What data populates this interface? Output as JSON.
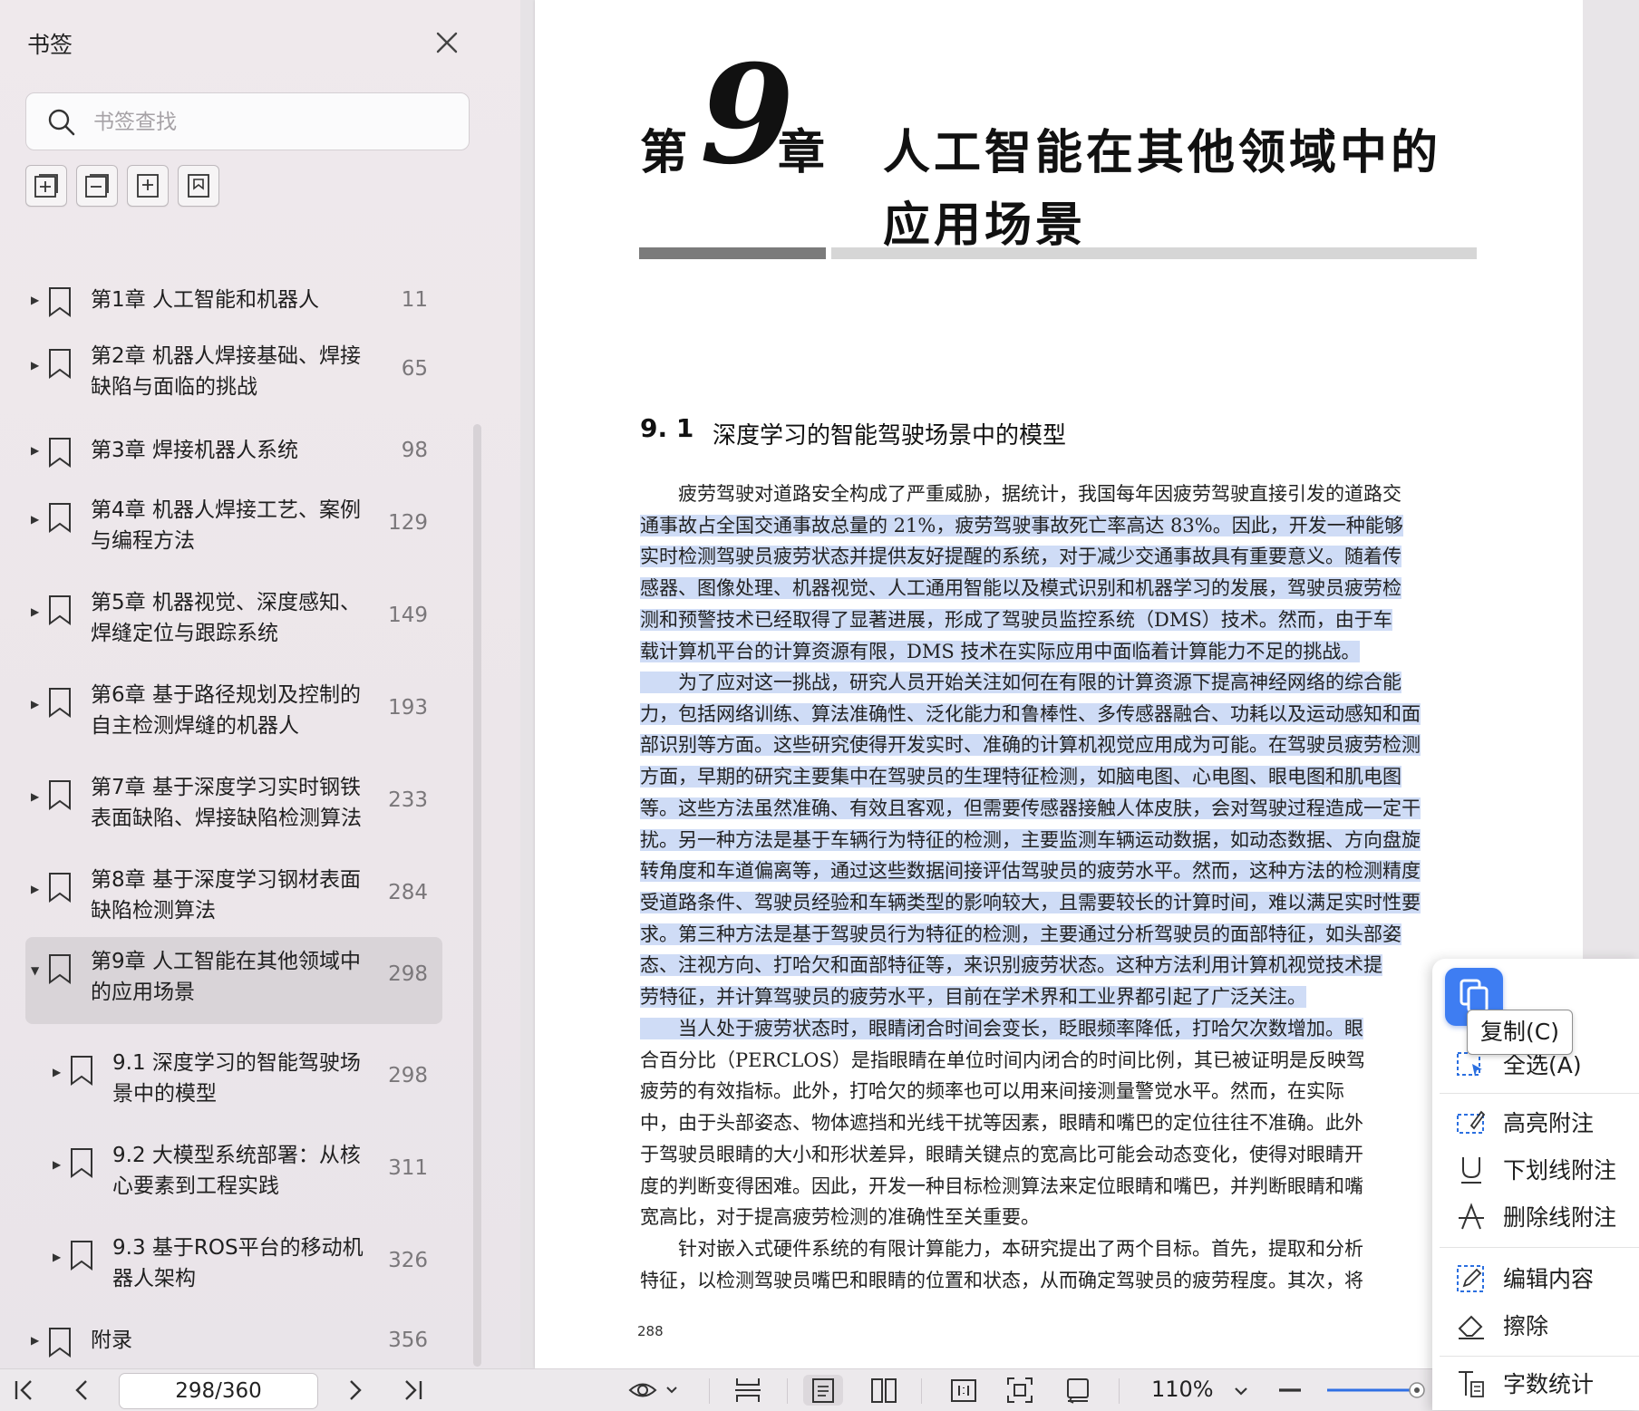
{
  "sidebar": {
    "title": "书签",
    "search_placeholder": "书签查找",
    "items": [
      {
        "label1": "第1章  人工智能和机器人",
        "label2": "",
        "page": "11"
      },
      {
        "label1": "第2章  机器人焊接基础、焊接",
        "label2": "缺陷与面临的挑战",
        "page": "65"
      },
      {
        "label1": "第3章  焊接机器人系统",
        "label2": "",
        "page": "98"
      },
      {
        "label1": "第4章  机器人焊接工艺、案例",
        "label2": "与编程方法",
        "page": "129"
      },
      {
        "label1": "第5章  机器视觉、深度感知、",
        "label2": "焊缝定位与跟踪系统",
        "page": "149"
      },
      {
        "label1": "第6章  基于路径规划及控制的",
        "label2": "自主检测焊缝的机器人",
        "page": "193"
      },
      {
        "label1": "第7章  基于深度学习实时钢铁",
        "label2": "表面缺陷、焊接缺陷检测算法",
        "page": "233"
      },
      {
        "label1": "第8章  基于深度学习钢材表面",
        "label2": "缺陷检测算法",
        "page": "284"
      },
      {
        "label1": "第9章  人工智能在其他领域中",
        "label2": "的应用场景",
        "page": "298"
      },
      {
        "label1": "9.1 深度学习的智能驾驶场",
        "label2": "景中的模型",
        "page": "298"
      },
      {
        "label1": "9.2 大模型系统部署：从核",
        "label2": "心要素到工程实践",
        "page": "311"
      },
      {
        "label1": "9.3 基于ROS平台的移动机",
        "label2": "器人架构",
        "page": "326"
      },
      {
        "label1": "附录",
        "label2": "",
        "page": "356"
      }
    ]
  },
  "document": {
    "chapter_prefix": "第",
    "chapter_number": "9",
    "chapter_suffix": "章",
    "chapter_title_line1": "人工智能在其他领域中的",
    "chapter_title_line2": "应用场景",
    "section_number": "9. 1",
    "section_title": "深度学习的智能驾驶场景中的模型",
    "p1_lines": [
      "　　疲劳驾驶对道路安全构成了严重威胁，据统计，我国每年因疲劳驾驶直接引发的道路交",
      "通事故占全国交通事故总量的 21%，疲劳驾驶事故死亡率高达 83%。因此，开发一种能够",
      "实时检测驾驶员疲劳状态并提供友好提醒的系统，对于减少交通事故具有重要意义。随着传",
      "感器、图像处理、机器视觉、人工通用智能以及模式识别和机器学习的发展，驾驶员疲劳检",
      "测和预警技术已经取得了显著进展，形成了驾驶员监控系统（DMS）技术。然而，由于车",
      "载计算机平台的计算资源有限，DMS 技术在实际应用中面临着计算能力不足的挑战。"
    ],
    "p2_lines": [
      "　　为了应对这一挑战，研究人员开始关注如何在有限的计算资源下提高神经网络的综合能",
      "力，包括网络训练、算法准确性、泛化能力和鲁棒性、多传感器融合、功耗以及运动感知和面",
      "部识别等方面。这些研究使得开发实时、准确的计算机视觉应用成为可能。在驾驶员疲劳检测",
      "方面，早期的研究主要集中在驾驶员的生理特征检测，如脑电图、心电图、眼电图和肌电图",
      "等。这些方法虽然准确、有效且客观，但需要传感器接触人体皮肤，会对驾驶过程造成一定干",
      "扰。另一种方法是基于车辆行为特征的检测，主要监测车辆运动数据，如动态数据、方向盘旋",
      "转角度和车道偏离等，通过这些数据间接评估驾驶员的疲劳水平。然而，这种方法的检测精度",
      "受道路条件、驾驶员经验和车辆类型的影响较大，且需要较长的计算时间，难以满足实时性要",
      "求。第三种方法是基于驾驶员行为特征的检测，主要通过分析驾驶员的面部特征，如头部姿",
      "态、注视方向、打哈欠和面部特征等，来识别疲劳状态。这种方法利用计算机视觉技术提",
      "劳特征，并计算驾驶员的疲劳水平，目前在学术界和工业界都引起了广泛关注。"
    ],
    "p3_lines": [
      "　　当人处于疲劳状态时，眼睛闭合时间会变长，眨眼频率降低，打哈欠次数增加。眼",
      "合百分比（PERCLOS）是指眼睛在单位时间内闭合的时间比例，其已被证明是反映驾",
      "疲劳的有效指标。此外，打哈欠的频率也可以用来间接测量警觉水平。然而，在实际",
      "中，由于头部姿态、物体遮挡和光线干扰等因素，眼睛和嘴巴的定位往往不准确。此外",
      "于驾驶员眼睛的大小和形状差异，眼睛关键点的宽高比可能会动态变化，使得对眼睛开",
      "度的判断变得困难。因此，开发一种目标检测算法来定位眼睛和嘴巴，并判断眼睛和嘴",
      "宽高比，对于提高疲劳检测的准确性至关重要。"
    ],
    "p4_lines": [
      "　　针对嵌入式硬件系统的有限计算能力，本研究提出了两个目标。首先，提取和分析",
      "特征，以检测驾驶员嘴巴和眼睛的位置和状态，从而确定驾驶员的疲劳程度。其次，将"
    ],
    "page_number": "288"
  },
  "bottom_bar": {
    "page_indicator": "298/360",
    "zoom": "110%"
  },
  "context_menu": {
    "tooltip": "复制(C)",
    "items": [
      "全选(A)",
      "高亮附注",
      "下划线附注",
      "删除线附注",
      "编辑内容",
      "擦除",
      "字数统计"
    ]
  },
  "colors": {
    "highlight": "#cfdcf6",
    "accent": "#3e7df2",
    "selection_bg": "#d9d4d8"
  }
}
